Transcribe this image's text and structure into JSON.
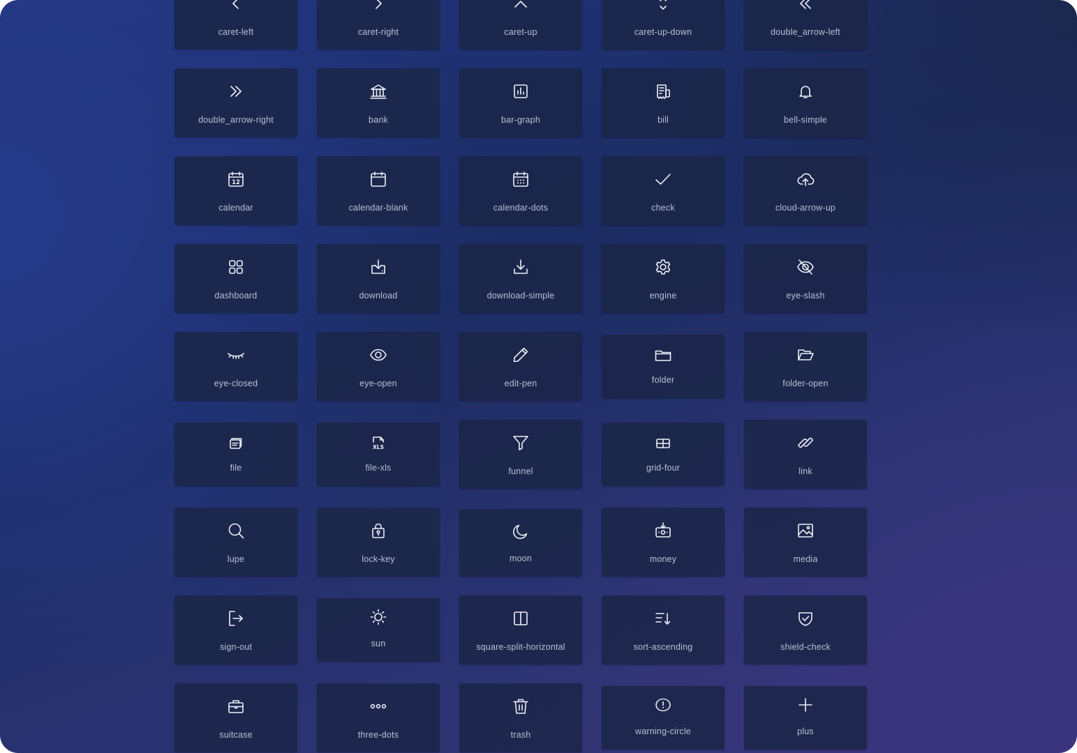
{
  "icon_library": {
    "icons": [
      {
        "label": "caret-left",
        "icon": "caret-left-icon"
      },
      {
        "label": "caret-right",
        "icon": "caret-right-icon"
      },
      {
        "label": "caret-up",
        "icon": "caret-up-icon"
      },
      {
        "label": "caret-up-down",
        "icon": "caret-up-down-icon"
      },
      {
        "label": "double_arrow-left",
        "icon": "double-arrow-left-icon"
      },
      {
        "label": "double_arrow-right",
        "icon": "double-arrow-right-icon"
      },
      {
        "label": "bank",
        "icon": "bank-icon"
      },
      {
        "label": "bar-graph",
        "icon": "bar-graph-icon"
      },
      {
        "label": "bill",
        "icon": "bill-icon"
      },
      {
        "label": "bell-simple",
        "icon": "bell-simple-icon"
      },
      {
        "label": "calendar",
        "icon": "calendar-icon"
      },
      {
        "label": "calendar-blank",
        "icon": "calendar-blank-icon"
      },
      {
        "label": "calendar-dots",
        "icon": "calendar-dots-icon"
      },
      {
        "label": "check",
        "icon": "check-icon"
      },
      {
        "label": "cloud-arrow-up",
        "icon": "cloud-arrow-up-icon"
      },
      {
        "label": "dashboard",
        "icon": "dashboard-icon"
      },
      {
        "label": "download",
        "icon": "download-icon"
      },
      {
        "label": "download-simple",
        "icon": "download-simple-icon"
      },
      {
        "label": "engine",
        "icon": "engine-icon"
      },
      {
        "label": "eye-slash",
        "icon": "eye-slash-icon"
      },
      {
        "label": "eye-closed",
        "icon": "eye-closed-icon"
      },
      {
        "label": "eye-open",
        "icon": "eye-open-icon"
      },
      {
        "label": "edit-pen",
        "icon": "edit-pen-icon"
      },
      {
        "label": "folder",
        "icon": "folder-icon"
      },
      {
        "label": "folder-open",
        "icon": "folder-open-icon"
      },
      {
        "label": "file",
        "icon": "file-icon"
      },
      {
        "label": "file-xls",
        "icon": "file-xls-icon"
      },
      {
        "label": "funnel",
        "icon": "funnel-icon"
      },
      {
        "label": "grid-four",
        "icon": "grid-four-icon"
      },
      {
        "label": "link",
        "icon": "link-icon"
      },
      {
        "label": "lupe",
        "icon": "lupe-icon"
      },
      {
        "label": "lock-key",
        "icon": "lock-key-icon"
      },
      {
        "label": "moon",
        "icon": "moon-icon"
      },
      {
        "label": "money",
        "icon": "money-icon"
      },
      {
        "label": "media",
        "icon": "media-icon"
      },
      {
        "label": "sign-out",
        "icon": "sign-out-icon"
      },
      {
        "label": "sun",
        "icon": "sun-icon"
      },
      {
        "label": "square-split-horizontal",
        "icon": "square-split-horizontal-icon"
      },
      {
        "label": "sort-ascending",
        "icon": "sort-ascending-icon"
      },
      {
        "label": "shield-check",
        "icon": "shield-check-icon"
      },
      {
        "label": "suitcase",
        "icon": "suitcase-icon"
      },
      {
        "label": "three-dots",
        "icon": "three-dots-icon"
      },
      {
        "label": "trash",
        "icon": "trash-icon"
      },
      {
        "label": "warning-circle",
        "icon": "warning-circle-icon"
      },
      {
        "label": "plus",
        "icon": "plus-icon"
      }
    ],
    "xls_badge": "XLS",
    "calendar_day": "12"
  },
  "colors": {
    "tile": "#1b2648",
    "icon": "#eef0f8",
    "label": "#b9bfd3",
    "background_start": "#22357f",
    "background_end": "#383576"
  }
}
